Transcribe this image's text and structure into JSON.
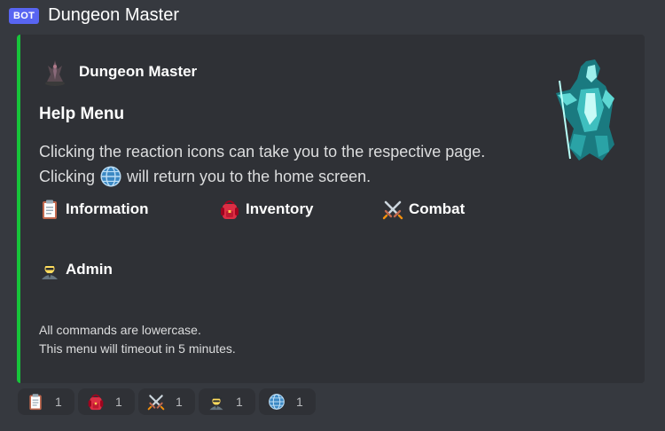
{
  "message": {
    "bot_tag": "BOT",
    "bot_name": "Dungeon Master"
  },
  "embed": {
    "accent_color": "#17c43a",
    "author_name": "Dungeon Master",
    "title": "Help Menu",
    "description_line1": "Clicking the reaction icons can take you to the respective page.",
    "description_line2_before": "Clicking",
    "description_line2_after": "will return you to the home screen.",
    "fields": [
      {
        "label": "Information",
        "icon": "clipboard-icon"
      },
      {
        "label": "Inventory",
        "icon": "backpack-icon"
      },
      {
        "label": "Combat",
        "icon": "crossed-swords-icon"
      },
      {
        "label": "Admin",
        "icon": "spy-icon"
      }
    ],
    "footer_line1": "All commands are lowercase.",
    "footer_line2": "This menu will timeout in 5 minutes."
  },
  "reactions": [
    {
      "icon": "clipboard-icon",
      "count": "1"
    },
    {
      "icon": "backpack-icon",
      "count": "1"
    },
    {
      "icon": "crossed-swords-icon",
      "count": "1"
    },
    {
      "icon": "spy-icon",
      "count": "1"
    },
    {
      "icon": "globe-icon",
      "count": "1"
    }
  ]
}
